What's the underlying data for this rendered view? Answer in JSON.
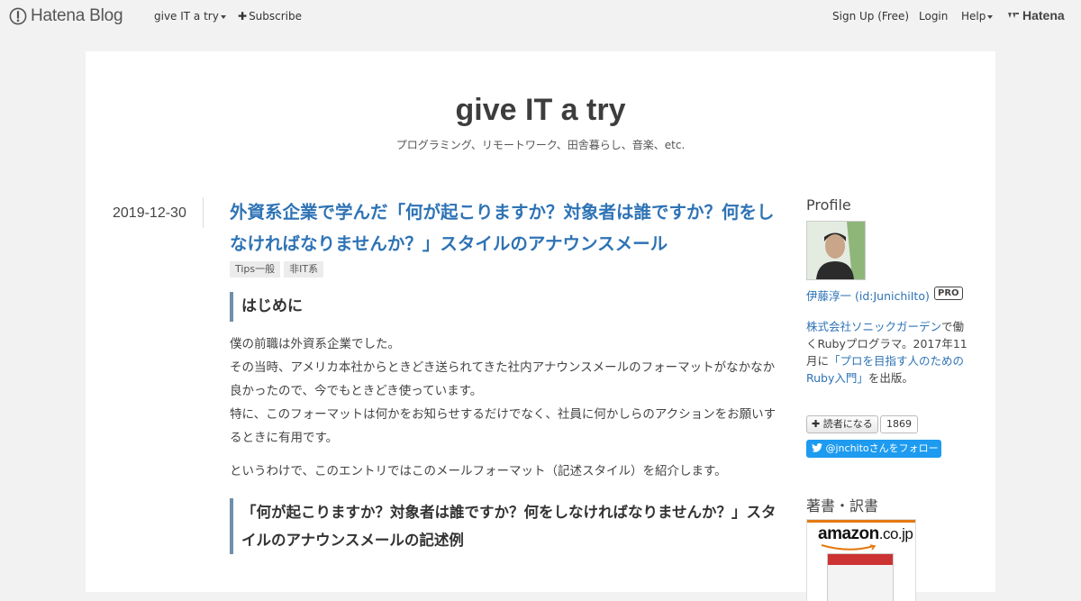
{
  "topbar": {
    "logo_text": "Hatena Blog",
    "blog_menu": "give IT a try",
    "subscribe": "Subscribe",
    "signup": "Sign Up (Free)",
    "login": "Login",
    "help": "Help",
    "hatena": "Hatena"
  },
  "header": {
    "title": "give IT a try",
    "description": "プログラミング、リモートワーク、田舎暮らし、音楽、etc."
  },
  "entry": {
    "date": "2019-12-30",
    "title": "外資系企業で学んだ「何が起こりますか？対象者は誰ですか？何をしなければなりませんか？」スタイルのアナウンスメール",
    "categories": [
      "Tips一般",
      "非IT系"
    ],
    "heading1": "はじめに",
    "paragraphs": [
      "僕の前職は外資系企業でした。",
      "その当時、アメリカ本社からときどき送られてきた社内アナウンスメールのフォーマットがなかなか良かったので、今でもときどき使っています。",
      "特に、このフォーマットは何かをお知らせするだけでなく、社員に何かしらのアクションをお願いするときに有用です。",
      "というわけで、このエントリではこのメールフォーマット（記述スタイル）を紹介します。"
    ],
    "heading2": "「何が起こりますか？対象者は誰ですか？何をしなければなりませんか？」スタイルのアナウンスメールの記述例"
  },
  "sidebar": {
    "profile_heading": "Profile",
    "user_name": "伊藤淳一 (id:JunichiIto)",
    "pro_badge": "PRO",
    "company_link": "株式会社ソニックガーデン",
    "desc_1": "で働くRubyプログラマ。2017年11月に",
    "book_link": "「プロを目指す人のためのRuby入門」",
    "desc_2": "を出版。",
    "reader_button": "読者になる",
    "reader_count": "1869",
    "twitter_button": "@jnchitoさんをフォロー",
    "books_heading": "著書・訳書",
    "amazon_logo": "amazon",
    "amazon_tld": ".co.jp"
  }
}
